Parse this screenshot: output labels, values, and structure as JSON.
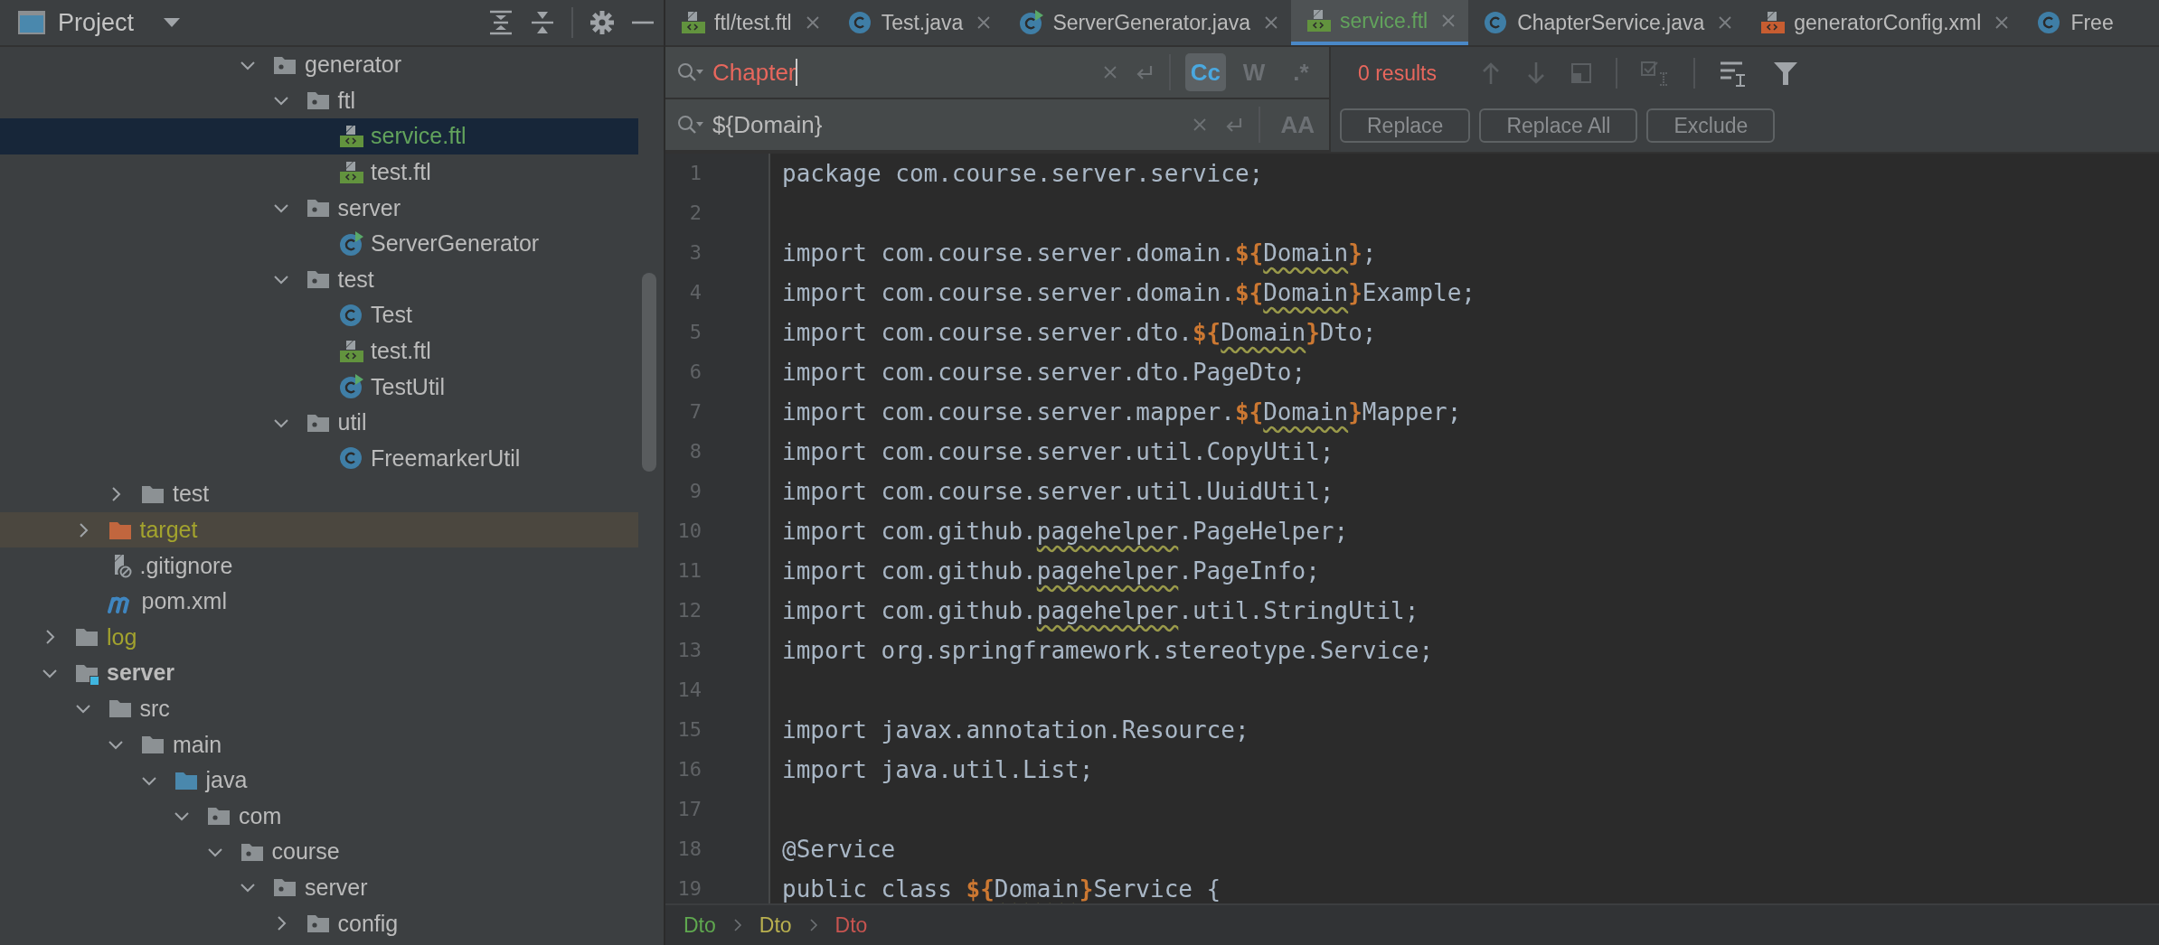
{
  "project_panel": {
    "title": "Project",
    "tree": [
      {
        "children": [
          {
            "children": [
              {
                "children": [
                  {
                    "children": [
                      {
                        "children": [
                          {
                            "children": [
                              {
                                "label": "generator",
                                "kind": "package",
                                "color": "#bbbbbb",
                                "expanded": true,
                                "selected": false,
                                "children": [
                                  {
                                    "label": "ftl",
                                    "kind": "package",
                                    "color": "#bbbbbb",
                                    "expanded": true,
                                    "selected": false,
                                    "children": [
                                      {
                                        "label": "service.ftl",
                                        "kind": "template",
                                        "color": "#62a35c",
                                        "selected": true
                                      },
                                      {
                                        "label": "test.ftl",
                                        "kind": "template",
                                        "color": "#bbbbbb",
                                        "selected": false
                                      }
                                    ]
                                  },
                                  {
                                    "label": "server",
                                    "kind": "package",
                                    "color": "#bbbbbb",
                                    "expanded": true,
                                    "selected": false,
                                    "children": [
                                      {
                                        "label": "ServerGenerator",
                                        "kind": "runnable-class",
                                        "color": "#bbbbbb",
                                        "selected": false
                                      }
                                    ]
                                  },
                                  {
                                    "label": "test",
                                    "kind": "package",
                                    "color": "#bbbbbb",
                                    "expanded": true,
                                    "selected": false,
                                    "children": [
                                      {
                                        "label": "Test",
                                        "kind": "class",
                                        "color": "#bbbbbb",
                                        "selected": false
                                      },
                                      {
                                        "label": "test.ftl",
                                        "kind": "template",
                                        "color": "#bbbbbb",
                                        "selected": false
                                      },
                                      {
                                        "label": "TestUtil",
                                        "kind": "runnable-class",
                                        "color": "#bbbbbb",
                                        "selected": false
                                      }
                                    ]
                                  },
                                  {
                                    "label": "util",
                                    "kind": "package",
                                    "color": "#bbbbbb",
                                    "expanded": true,
                                    "selected": false,
                                    "children": [
                                      {
                                        "label": "FreemarkerUtil",
                                        "kind": "class",
                                        "color": "#bbbbbb",
                                        "selected": false
                                      }
                                    ]
                                  }
                                ]
                              }
                            ]
                          }
                        ]
                      }
                    ]
                  }
                ]
              },
              {
                "label": "test",
                "kind": "folder",
                "color": "#bbbbbb",
                "expanded": false,
                "selected": false
              }
            ]
          },
          {
            "label": "target",
            "kind": "excluded",
            "color": "#a3a32e",
            "expanded": false,
            "selected": false
          },
          {
            "label": ".gitignore",
            "kind": "ignorefile",
            "color": "#bbbbbb",
            "selected": false
          },
          {
            "label": "pom.xml",
            "kind": "maven",
            "color": "#bbbbbb",
            "selected": false
          }
        ]
      },
      {
        "label": "log",
        "kind": "folder",
        "color": "#a3a32e",
        "expanded": false,
        "selected": false
      },
      {
        "label": "server",
        "kind": "module",
        "color": "#bbbbbb",
        "expanded": true,
        "selected": false,
        "children": [
          {
            "label": "src",
            "kind": "folder",
            "color": "#bbbbbb",
            "expanded": true,
            "selected": false,
            "children": [
              {
                "label": "main",
                "kind": "folder",
                "color": "#bbbbbb",
                "expanded": true,
                "selected": false,
                "children": [
                  {
                    "label": "java",
                    "kind": "sources",
                    "color": "#bbbbbb",
                    "expanded": true,
                    "selected": false,
                    "children": [
                      {
                        "label": "com",
                        "kind": "package",
                        "color": "#bbbbbb",
                        "expanded": true,
                        "selected": false,
                        "children": [
                          {
                            "label": "course",
                            "kind": "package",
                            "color": "#bbbbbb",
                            "expanded": true,
                            "selected": false,
                            "children": [
                              {
                                "label": "server",
                                "kind": "package",
                                "color": "#bbbbbb",
                                "expanded": true,
                                "selected": false,
                                "children": [
                                  {
                                    "label": "config",
                                    "kind": "package",
                                    "color": "#bbbbbb",
                                    "expanded": false,
                                    "selected": false
                                  }
                                ]
                              }
                            ]
                          }
                        ]
                      }
                    ]
                  }
                ]
              }
            ]
          }
        ]
      }
    ]
  },
  "editor_tabs": [
    {
      "label": "ftl/test.ftl",
      "kind": "template",
      "color": "#bbbbbb",
      "selected": false,
      "closable": true
    },
    {
      "label": "Test.java",
      "kind": "class",
      "color": "#bbbbbb",
      "selected": false,
      "closable": true
    },
    {
      "label": "ServerGenerator.java",
      "kind": "runnable-class",
      "color": "#bbbbbb",
      "selected": false,
      "closable": true
    },
    {
      "label": "service.ftl",
      "kind": "template",
      "color": "#62a35c",
      "selected": true,
      "closable": true
    },
    {
      "label": "ChapterService.java",
      "kind": "class",
      "color": "#bbbbbb",
      "selected": false,
      "closable": true
    },
    {
      "label": "generatorConfig.xml",
      "kind": "xml",
      "color": "#bbbbbb",
      "selected": false,
      "closable": true
    },
    {
      "label": "Free",
      "kind": "class",
      "color": "#bbbbbb",
      "selected": false,
      "closable": false
    }
  ],
  "find": {
    "search": {
      "value": "Chapter",
      "no_match": true
    },
    "search_toggles": [
      {
        "label": "Cc",
        "selected": true
      },
      {
        "label": "W",
        "selected": false
      },
      {
        "label": ".*",
        "selected": false
      }
    ],
    "replace": {
      "value": "${Domain}"
    },
    "replace_toggles": [
      {
        "label": "AA",
        "selected": false
      }
    ],
    "results": "0 results",
    "buttons": [
      "Replace",
      "Replace All",
      "Exclude"
    ]
  },
  "code": {
    "lines": [
      {
        "number": "1",
        "segments": [
          {
            "kind": "plain",
            "text": "package com.course.server.service;"
          }
        ]
      },
      {
        "number": "2"
      },
      {
        "number": "3",
        "segments": [
          {
            "kind": "plain",
            "text": "import com.course.server.domain."
          },
          {
            "kind": "interp",
            "text": "${"
          },
          {
            "kind": "typo",
            "text": "Domain"
          },
          {
            "kind": "interp",
            "text": "}"
          },
          {
            "kind": "plain",
            "text": ";"
          }
        ]
      },
      {
        "number": "4",
        "segments": [
          {
            "kind": "plain",
            "text": "import com.course.server.domain."
          },
          {
            "kind": "interp",
            "text": "${"
          },
          {
            "kind": "typo",
            "text": "Domain"
          },
          {
            "kind": "interp",
            "text": "}"
          },
          {
            "kind": "plain",
            "text": "Example;"
          }
        ]
      },
      {
        "number": "5",
        "segments": [
          {
            "kind": "plain",
            "text": "import com.course.server.dto."
          },
          {
            "kind": "interp",
            "text": "${"
          },
          {
            "kind": "typo",
            "text": "Domain"
          },
          {
            "kind": "interp",
            "text": "}"
          },
          {
            "kind": "plain",
            "text": "Dto;"
          }
        ]
      },
      {
        "number": "6",
        "segments": [
          {
            "kind": "plain",
            "text": "import com.course.server.dto.PageDto;"
          }
        ]
      },
      {
        "number": "7",
        "segments": [
          {
            "kind": "plain",
            "text": "import com.course.server.mapper."
          },
          {
            "kind": "interp",
            "text": "${"
          },
          {
            "kind": "typo",
            "text": "Domain"
          },
          {
            "kind": "interp",
            "text": "}"
          },
          {
            "kind": "plain",
            "text": "Mapper;"
          }
        ]
      },
      {
        "number": "8",
        "segments": [
          {
            "kind": "plain",
            "text": "import com.course.server.util.CopyUtil;"
          }
        ]
      },
      {
        "number": "9",
        "segments": [
          {
            "kind": "plain",
            "text": "import com.course.server.util.UuidUtil;"
          }
        ]
      },
      {
        "number": "10",
        "segments": [
          {
            "kind": "plain",
            "text": "import com.github."
          },
          {
            "kind": "typo",
            "text": "pagehelper"
          },
          {
            "kind": "plain",
            "text": ".PageHelper;"
          }
        ]
      },
      {
        "number": "11",
        "segments": [
          {
            "kind": "plain",
            "text": "import com.github."
          },
          {
            "kind": "typo",
            "text": "pagehelper"
          },
          {
            "kind": "plain",
            "text": ".PageInfo;"
          }
        ]
      },
      {
        "number": "12",
        "segments": [
          {
            "kind": "plain",
            "text": "import com.github."
          },
          {
            "kind": "typo",
            "text": "pagehelper"
          },
          {
            "kind": "plain",
            "text": ".util.StringUtil;"
          }
        ]
      },
      {
        "number": "13",
        "segments": [
          {
            "kind": "plain",
            "text": "import org.springframework.stereotype.Service;"
          }
        ]
      },
      {
        "number": "14"
      },
      {
        "number": "15",
        "segments": [
          {
            "kind": "plain",
            "text": "import javax.annotation.Resource;"
          }
        ]
      },
      {
        "number": "16",
        "segments": [
          {
            "kind": "plain",
            "text": "import java.util.List;"
          }
        ]
      },
      {
        "number": "17"
      },
      {
        "number": "18",
        "segments": [
          {
            "kind": "plain",
            "text": "@Service"
          }
        ]
      },
      {
        "number": "19",
        "segments": [
          {
            "kind": "plain",
            "text": "public class "
          },
          {
            "kind": "interp",
            "text": "${"
          },
          {
            "kind": "typo",
            "text": "Domain"
          },
          {
            "kind": "interp",
            "text": "}"
          },
          {
            "kind": "plain",
            "text": "Service {"
          }
        ]
      }
    ]
  },
  "breadcrumbs": [
    {
      "label": "Dto",
      "color": "#5fa84f"
    },
    {
      "label": "Dto",
      "color": "#b9b04f"
    },
    {
      "label": "Dto",
      "color": "#c75450"
    }
  ]
}
